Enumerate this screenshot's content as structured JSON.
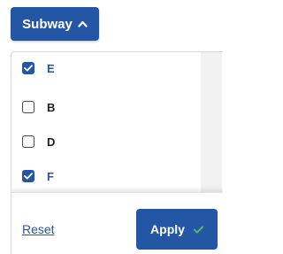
{
  "filter_button": {
    "label": "Subway",
    "icon": "chevron-up-icon"
  },
  "options": [
    {
      "label": "E",
      "checked": true
    },
    {
      "label": "B",
      "checked": false
    },
    {
      "label": "D",
      "checked": false
    },
    {
      "label": "F",
      "checked": true
    }
  ],
  "footer": {
    "reset_label": "Reset",
    "apply_label": "Apply",
    "apply_icon": "checkmark-icon"
  },
  "colors": {
    "primary": "#2456a6",
    "checkmark": "#5cb85c",
    "scrollbar_track": "#f2f2f2"
  }
}
